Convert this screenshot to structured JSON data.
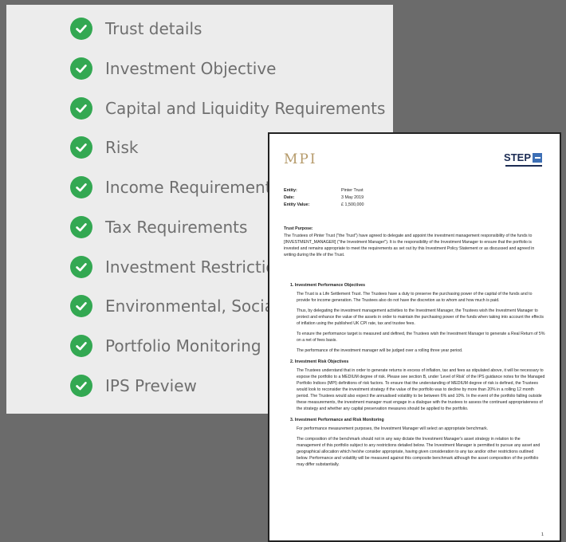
{
  "checklist": {
    "items": [
      {
        "label": "Trust details"
      },
      {
        "label": "Investment Objective"
      },
      {
        "label": "Capital and Liquidity Requirements"
      },
      {
        "label": "Risk"
      },
      {
        "label": "Income Requirement"
      },
      {
        "label": "Tax Requirements"
      },
      {
        "label": "Investment Restrictions"
      },
      {
        "label": "Environmental, Social and Governance"
      },
      {
        "label": "Portfolio Monitoring"
      },
      {
        "label": "IPS Preview"
      }
    ],
    "check_color": "#33a852"
  },
  "document": {
    "logo_left": "MPI",
    "logo_right": "STEP",
    "meta": [
      {
        "key": "Entity:",
        "value": "Pinter Trust"
      },
      {
        "key": "Date:",
        "value": "3 May 2019"
      },
      {
        "key": "Entity Value:",
        "value": "£ 1,500,000"
      }
    ],
    "purpose_heading": "Trust Purpose:",
    "purpose_text": "The Trustees of Pinter Trust (\"the Trust\") have agreed to delegate and appoint the investment management responsibility of the funds to [INVESTMENT_MANAGER] (\"the Investment Manager\"). It is the responsibility of the Investment Manager to ensure that the portfolio is invested and remains appropriate to meet the requirements as set out by this Investment Policy Statement or as discussed and agreed in writing during the life of the Trust.",
    "sections": [
      {
        "title": "1. Investment Performance Objectives",
        "paragraphs": [
          "The Trust is a Life Settlement Trust. The Trustees have a duty to preserve the purchasing power of the capital of the funds and to provide for income generation. The Trustees also do not have the discretion as to whom and how much is paid.",
          "Thus, by delegating the investment management activities to the Investment Manager, the Trustees wish the Investment Manager to protect and enhance the value of the assets in order to maintain the purchasing power of the funds when taking into account the effects of inflation using the published UK CPI rate, tax and trustee fees.",
          "To ensure the performance target is measured and defined, the Trustees wish the Investment Manager to generate a Real Return of 5% on a net of fees basis.",
          "The performance of the investment manager will be judged over a rolling three year period."
        ]
      },
      {
        "title": "2. Investment Risk Objectives",
        "paragraphs": [
          "The Trustees understand that in order to generate returns in excess of inflation, tax and fees as stipulated above, it will be necessary to expose the portfolio to a MEDIUM degree of risk. Please see section B, under 'Level of Risk' of the IPS guidance notes for the Managed Portfolio Indices (MPI) definitions of risk factors. To ensure that the understanding of MEDIUM degree of risk is defined, the Trustees would look to reconsider the investment strategy if the value of the portfolio was to decline by more than 20% in a rolling 12 month period. The Trustees would also expect the annualised volatility to be between 6% and 10%. In the event of the portfolio falling outside these measurements, the investment manager must engage in a dialogue with the trustees to assess the continued appropriateness of the strategy and whether any capital preservation measures should be applied to the portfolio."
        ]
      },
      {
        "title": "3. Investment Performance and Risk Monitoring",
        "paragraphs": [
          "For performance measurement purposes, the Investment Manager will select an appropriate benchmark.",
          "The composition of the benchmark should not in any way dictate the Investment Manager's asset strategy in relation to the management of this portfolio subject to any restrictions detailed below. The Investment Manager is permitted to pursue any asset and geographical allocation which he/she consider appropriate, having given consideration to any tax and/or other restrictions outlined below. Performance and volatility will be measured against this composite benchmark although the asset composition of the portfolio may differ substantially."
        ]
      }
    ],
    "page_number": "1"
  }
}
